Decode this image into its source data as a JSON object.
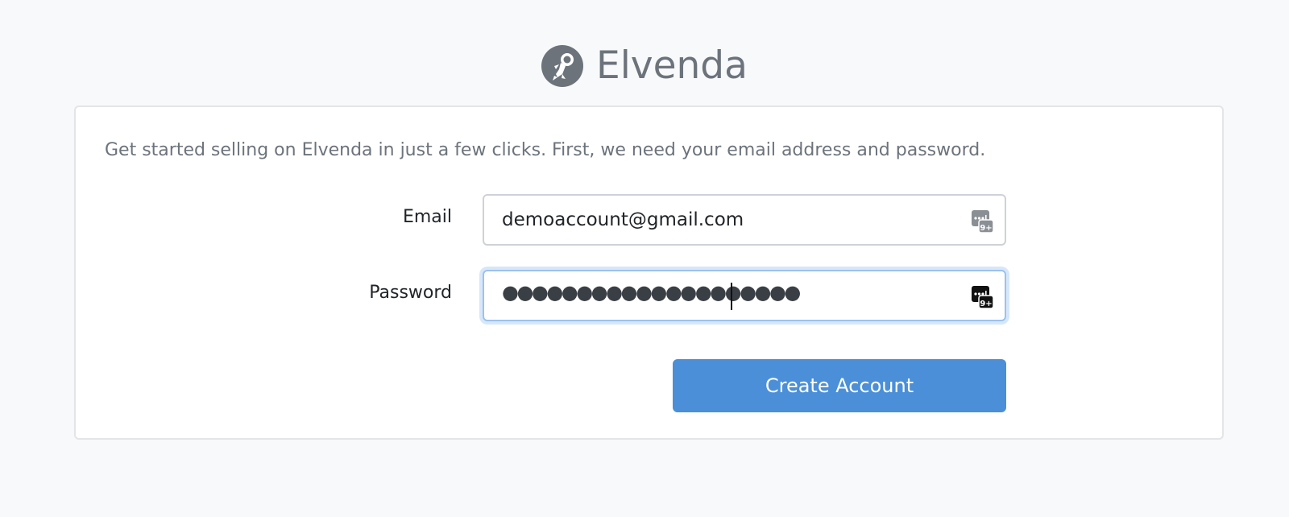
{
  "brand": {
    "name": "Elvenda",
    "logo_icon": "astronaut-icon"
  },
  "intro": "Get started selling on Elvenda in just a few clicks. First, we need your email address and password.",
  "form": {
    "email_label": "Email",
    "email_value": "demoaccount@gmail.com",
    "password_label": "Password",
    "password_masked": "●●●●●●●●●●●●●●●●●●●●",
    "password_manager_icon": "password-manager-icon",
    "password_manager_badge": "9+",
    "submit_label": "Create Account"
  },
  "colors": {
    "background": "#f8f9fb",
    "primary_button": "#4a8fd7",
    "muted_text": "#6c737b",
    "focus_ring": "#9cc2ee"
  }
}
